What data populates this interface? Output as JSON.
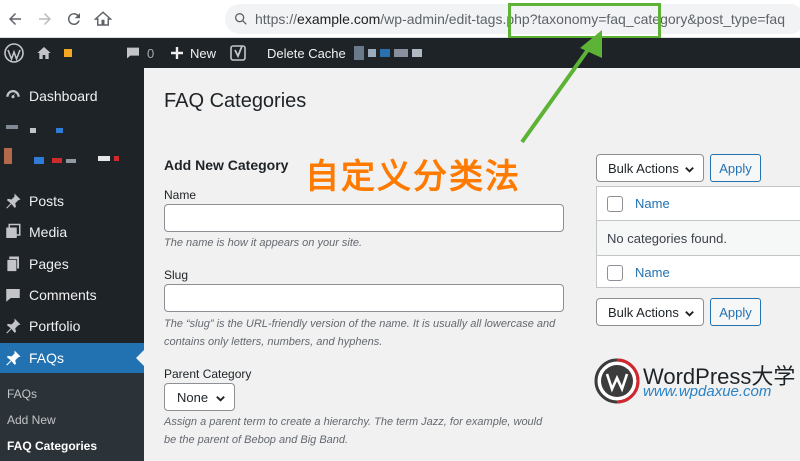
{
  "browser": {
    "url_prefix": "https://",
    "url_host": "example.com",
    "url_path": "/wp-admin/edit-tags.php?taxonomy=faq_category&post_type=faq"
  },
  "admin_bar": {
    "comments_count": "0",
    "new_label": "New",
    "delete_cache_label": "Delete Cache"
  },
  "sidebar": {
    "items": [
      {
        "label": "Dashboard",
        "icon": "dashboard-icon"
      },
      {
        "label": "Posts",
        "icon": "pin-icon"
      },
      {
        "label": "Media",
        "icon": "media-icon"
      },
      {
        "label": "Pages",
        "icon": "pages-icon"
      },
      {
        "label": "Comments",
        "icon": "comment-icon"
      },
      {
        "label": "Portfolio",
        "icon": "pin-icon"
      },
      {
        "label": "FAQs",
        "icon": "pin-icon"
      }
    ],
    "submenu": [
      "FAQs",
      "Add New",
      "FAQ Categories"
    ]
  },
  "page": {
    "title": "FAQ Categories",
    "form_heading": "Add New Category",
    "name_label": "Name",
    "name_help": "The name is how it appears on your site.",
    "slug_label": "Slug",
    "slug_help": "The “slug” is the URL-friendly version of the name. It is usually all lowercase and contains only letters, numbers, and hyphens.",
    "parent_label": "Parent Category",
    "parent_value": "None",
    "parent_help": "Assign a parent term to create a hierarchy. The term Jazz, for example, would be the parent of Bebop and Big Band."
  },
  "annotation": "自定义分类法",
  "table": {
    "bulk_actions": "Bulk Actions",
    "apply": "Apply",
    "column_name": "Name",
    "empty_message": "No categories found."
  },
  "watermark": {
    "title": "WordPress大学",
    "url": "www.wpdaxue.com"
  },
  "colors": {
    "admin_bg": "#1d2327",
    "accent": "#2271b1",
    "highlight_box": "#5cb335",
    "annotation": "#ff7a00"
  }
}
